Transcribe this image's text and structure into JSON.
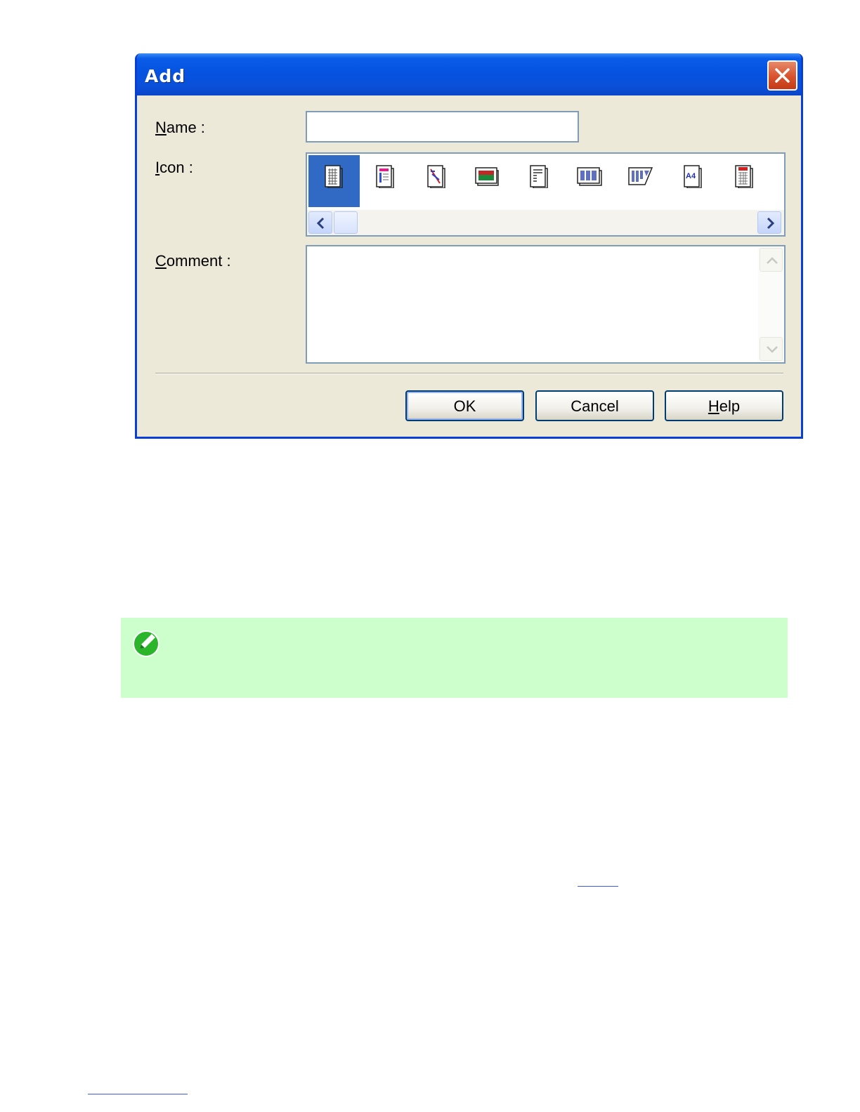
{
  "dialog": {
    "title": "Add",
    "name_label": "Name :",
    "name_value": "",
    "icon_label": "Icon :",
    "comment_label": "Comment :",
    "comment_value": "",
    "buttons": {
      "ok": "OK",
      "cancel": "Cancel",
      "help": "Help"
    },
    "icons": [
      {
        "name": "grid-page-icon",
        "selected": true
      },
      {
        "name": "colored-page-icon",
        "selected": false
      },
      {
        "name": "crossed-page-icon",
        "selected": false
      },
      {
        "name": "photo-page-icon",
        "selected": false
      },
      {
        "name": "text-page-icon",
        "selected": false
      },
      {
        "name": "multi-column-page-icon",
        "selected": false
      },
      {
        "name": "slanted-columns-page-icon",
        "selected": false
      },
      {
        "name": "a4-page-icon",
        "selected": false
      },
      {
        "name": "red-header-page-icon",
        "selected": false
      }
    ],
    "a4_icon_text": "A4"
  },
  "colors": {
    "titlebar": "#0553e0",
    "dialog_bg": "#ece9d8",
    "selection": "#316ac5",
    "note_bg": "#ccffcc",
    "close_button": "#d8522d"
  }
}
